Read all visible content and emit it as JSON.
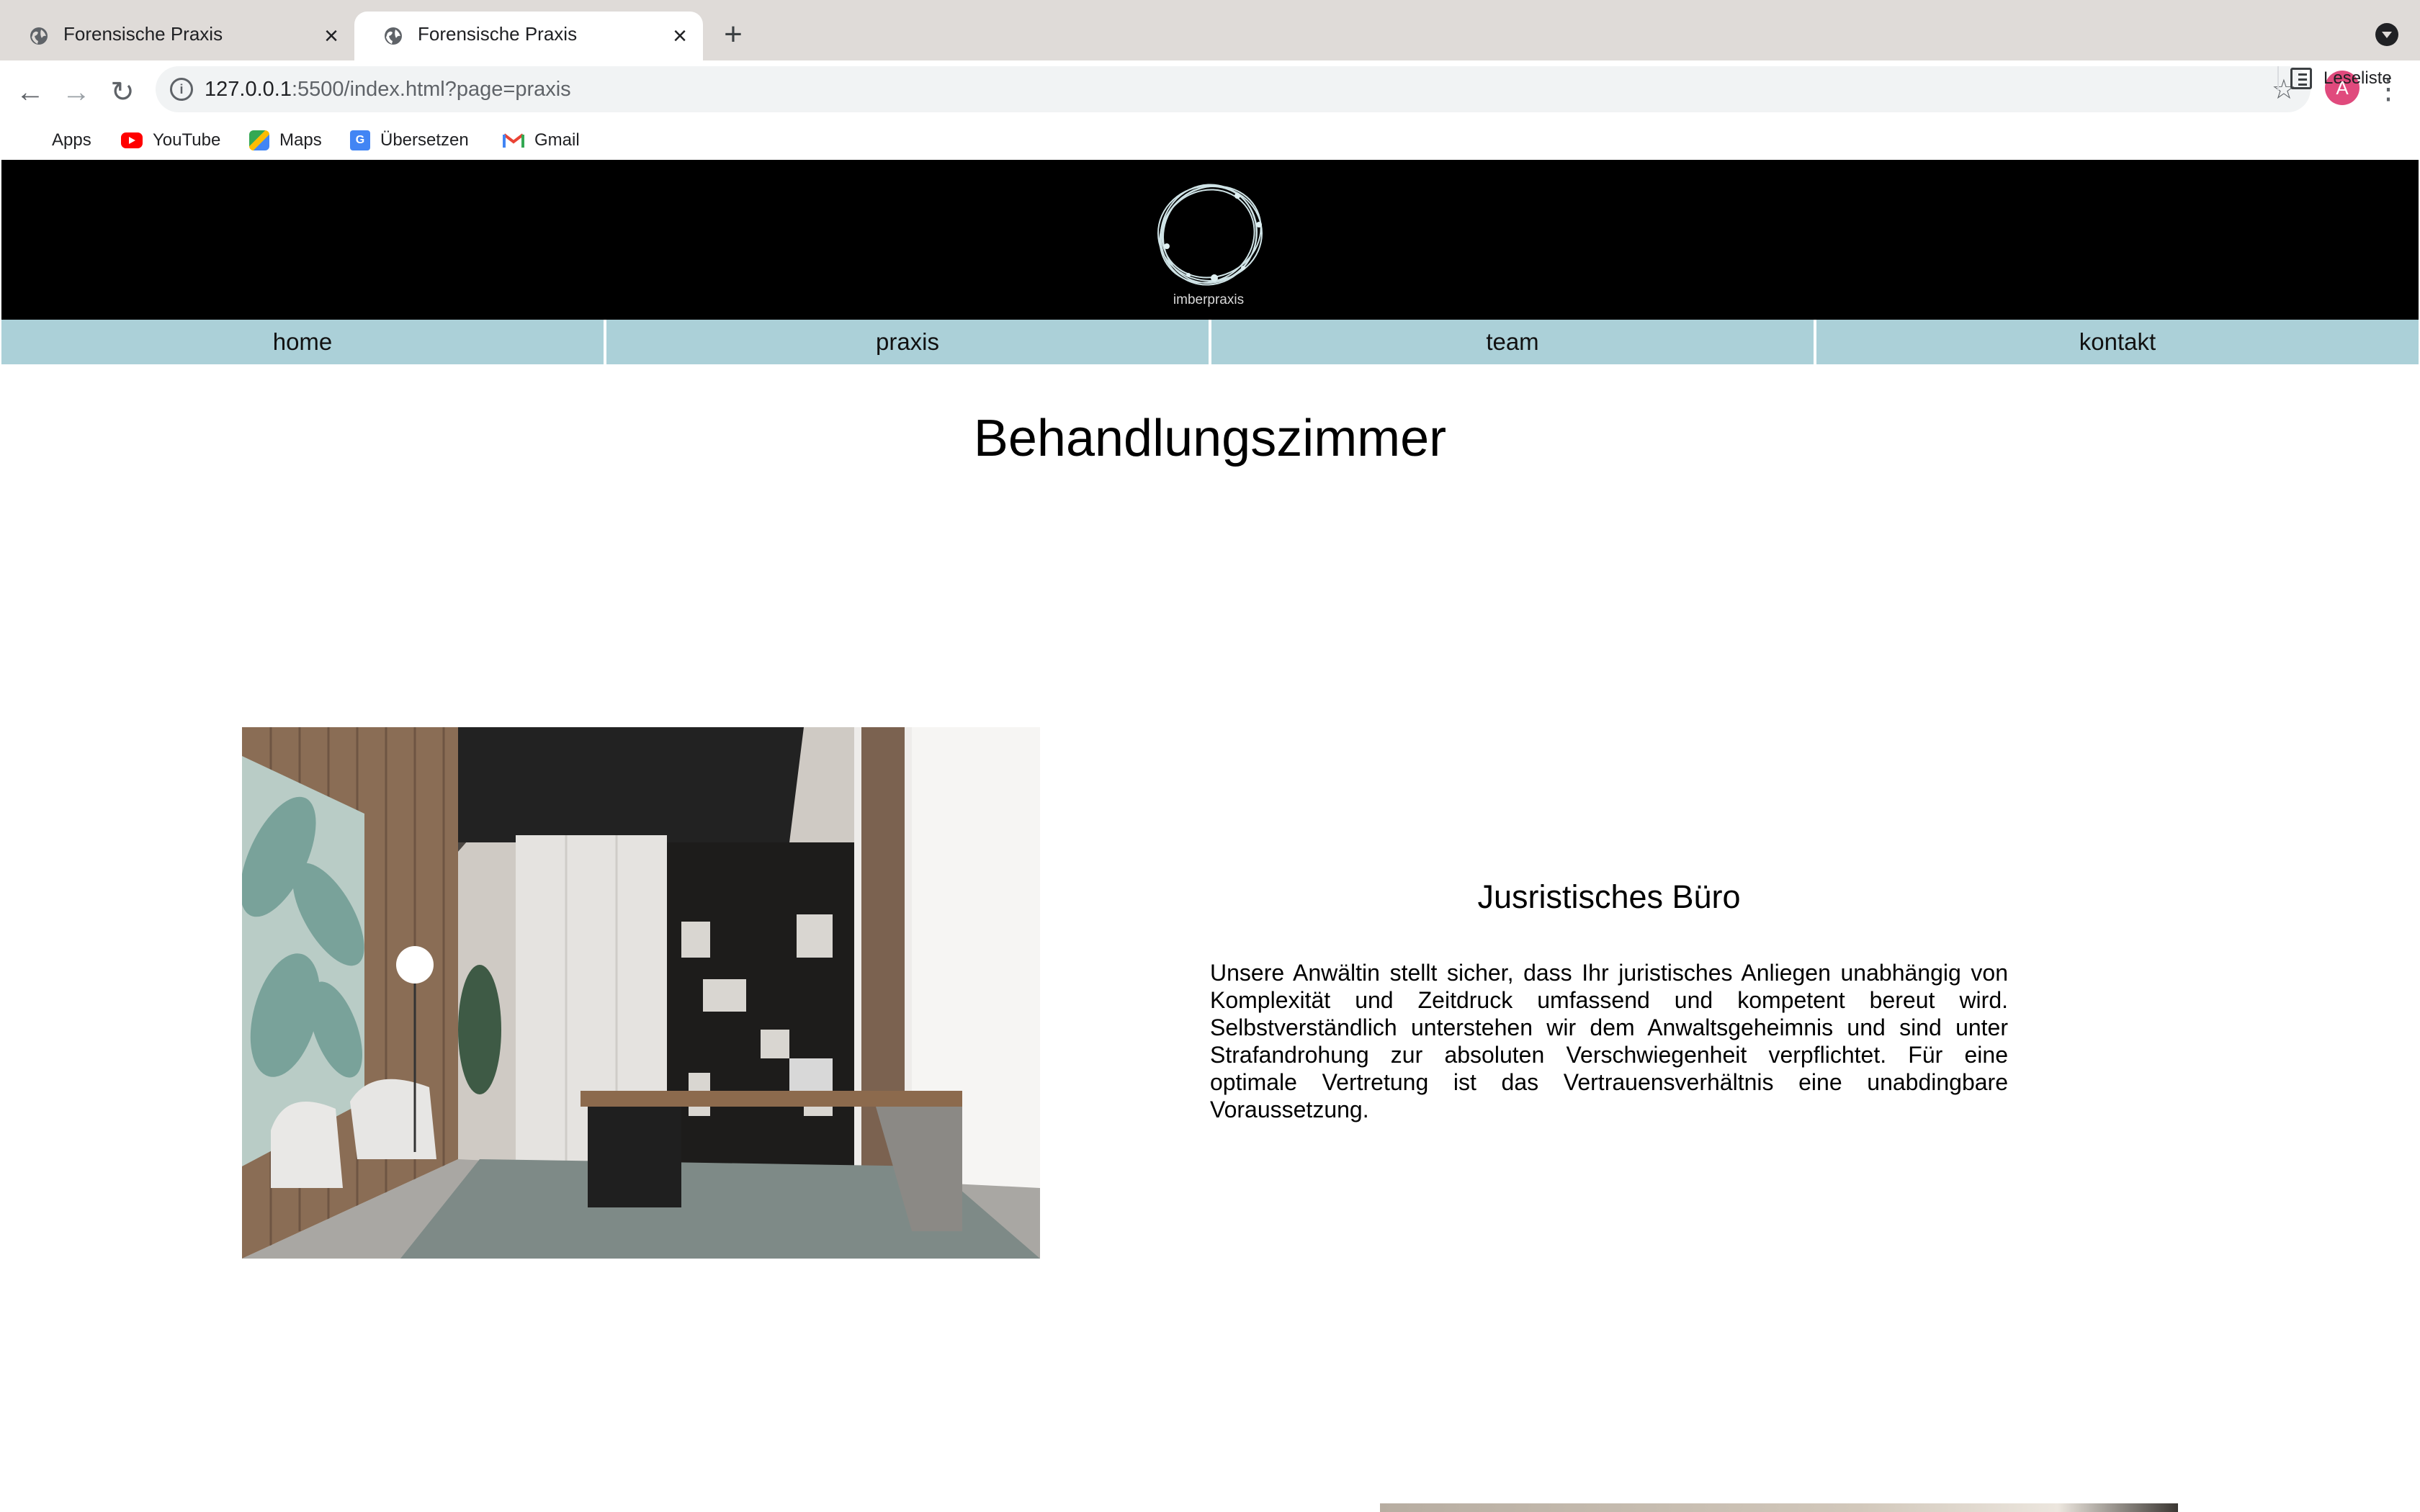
{
  "browser": {
    "tabs": [
      {
        "title": "Forensische Praxis",
        "active": false
      },
      {
        "title": "Forensische Praxis",
        "active": true
      }
    ],
    "url": {
      "host": "127.0.0.1",
      "rest": ":5500/index.html?page=praxis"
    },
    "profile_initial": "A",
    "bookmarks": [
      "Apps",
      "YouTube",
      "Maps",
      "Übersetzen",
      "Gmail"
    ],
    "reading_list": "Leseliste"
  },
  "site": {
    "logo_text": "imberpraxis",
    "nav": [
      "home",
      "praxis",
      "team",
      "kontakt"
    ]
  },
  "main": {
    "title": "Behandlungszimmer",
    "section": {
      "heading": "Jusristisches Büro",
      "text": "Unsere Anwältin stellt sicher, dass Ihr juristisches Anliegen unabhängig von Komplexität und Zeitdruck umfassend und kompetent bereut wird. Selbstverständlich unterstehen wir dem Anwaltsgeheimnis und sind unter Strafandrohung zur absoluten Verschwiegenheit verpflichtet. Für eine optimale Vertretung ist das Vertrauensverhältnis eine unabdingbare Voraussetzung."
    }
  },
  "colors": {
    "header_bg": "#000000",
    "nav_bg": "#abd0d8",
    "tabstrip_bg": "#dfdbd8",
    "profile_bg": "#e04a7d"
  }
}
